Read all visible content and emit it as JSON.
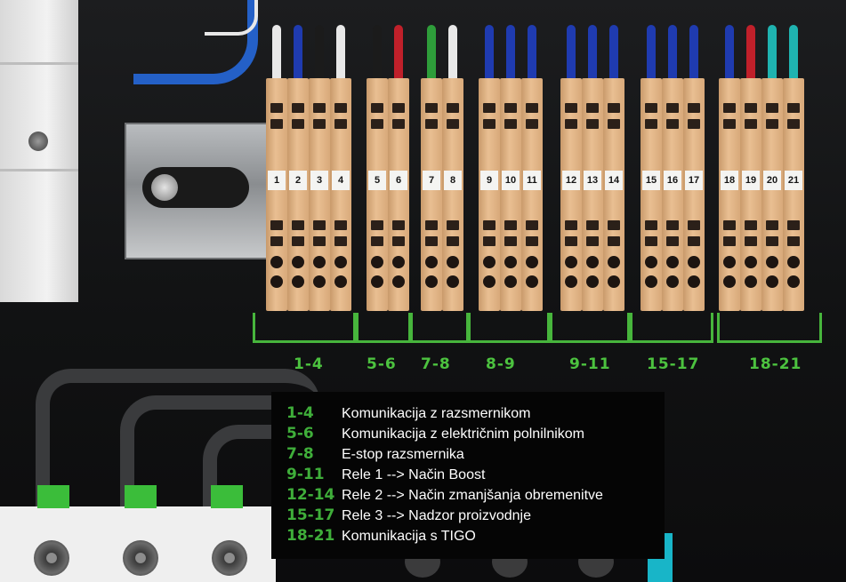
{
  "terminals": [
    {
      "number": "1",
      "wire": "white"
    },
    {
      "number": "2",
      "wire": "blue"
    },
    {
      "number": "3",
      "wire": "black"
    },
    {
      "number": "4",
      "wire": "white"
    },
    {
      "number": "5",
      "wire": "black"
    },
    {
      "number": "6",
      "wire": "red"
    },
    {
      "number": "7",
      "wire": "green"
    },
    {
      "number": "8",
      "wire": "white"
    },
    {
      "number": "9",
      "wire": "blue"
    },
    {
      "number": "10",
      "wire": "blue"
    },
    {
      "number": "11",
      "wire": "blue"
    },
    {
      "number": "12",
      "wire": "blue"
    },
    {
      "number": "13",
      "wire": "blue"
    },
    {
      "number": "14",
      "wire": "blue"
    },
    {
      "number": "15",
      "wire": "blue"
    },
    {
      "number": "16",
      "wire": "blue"
    },
    {
      "number": "17",
      "wire": "blue"
    },
    {
      "number": "18",
      "wire": "blue"
    },
    {
      "number": "19",
      "wire": "red"
    },
    {
      "number": "20",
      "wire": "teal"
    },
    {
      "number": "21",
      "wire": "teal"
    }
  ],
  "range_labels": [
    "1-4",
    "5-6",
    "7-8",
    "8-9",
    "9-11",
    "15-17",
    "18-21"
  ],
  "legend": [
    {
      "key": "1-4",
      "text": "Komunikacija z razsmernikom"
    },
    {
      "key": "5-6",
      "text": "Komunikacija z električnim polnilnikom"
    },
    {
      "key": "7-8",
      "text": "E-stop razsmernika"
    },
    {
      "key": "9-11",
      "text": "Rele 1 --> Način Boost"
    },
    {
      "key": "12-14",
      "text": "Rele 2 --> Način zmanjšanja obremenitve"
    },
    {
      "key": "15-17",
      "text": "Rele 3 --> Nadzor proizvodnje"
    },
    {
      "key": "18-21",
      "text": "Komunikacija s TIGO"
    }
  ],
  "colors": {
    "accent_green": "#47b53c",
    "terminal": "#e2b488",
    "wire_blue": "#1f3bb0",
    "wire_red": "#c0202a",
    "wire_teal": "#1fb3b0",
    "wire_green": "#2e9d3a",
    "wire_white": "#e8e8e8",
    "wire_black": "#1b1b1b",
    "legend_bg": "#050505",
    "legend_text": "#ffffff"
  }
}
